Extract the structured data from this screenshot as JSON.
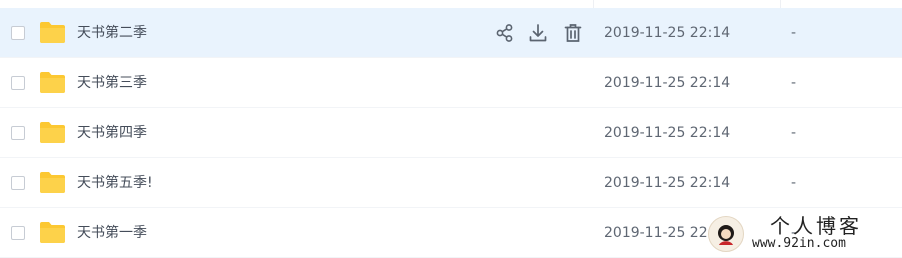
{
  "files": [
    {
      "name": "天书第二季",
      "date": "2019-11-25 22:14",
      "size": "-",
      "hover": true
    },
    {
      "name": "天书第三季",
      "date": "2019-11-25 22:14",
      "size": "-",
      "hover": false
    },
    {
      "name": "天书第四季",
      "date": "2019-11-25 22:14",
      "size": "-",
      "hover": false
    },
    {
      "name": "天书第五季!",
      "date": "2019-11-25 22:14",
      "size": "-",
      "hover": false
    },
    {
      "name": "天书第一季",
      "date": "2019-11-25 22:14",
      "size": "-",
      "hover": false
    }
  ],
  "row_actions": [
    "share-icon",
    "download-icon",
    "delete-icon"
  ],
  "colors": {
    "hover_bg": "#e9f3fd",
    "folder": "#fcc832",
    "icon": "#5b6470"
  },
  "watermark": {
    "title": "个人博客",
    "url": "www.92in.com"
  }
}
